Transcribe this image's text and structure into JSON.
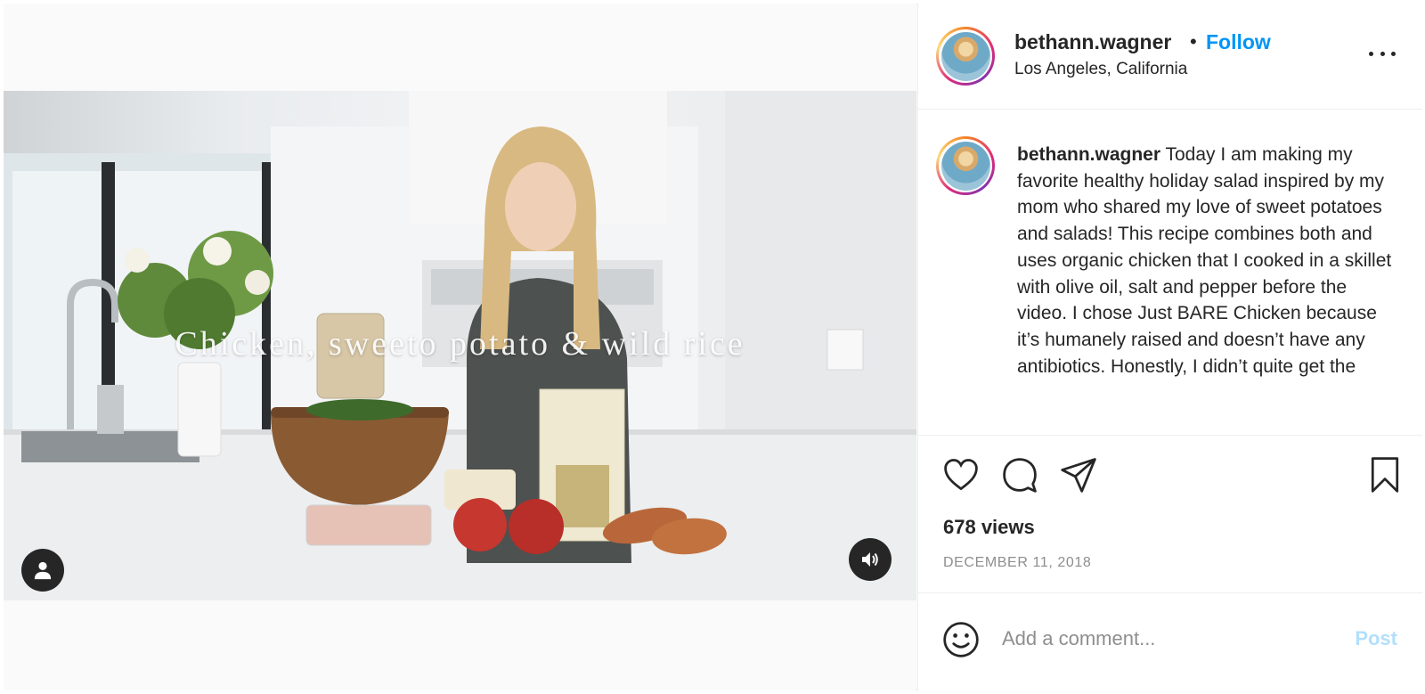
{
  "post": {
    "overlay_text": "Chicken, sweeto potato & wild rice",
    "media_icons": {
      "user_tag": "person-icon",
      "sound": "speaker-icon"
    }
  },
  "header": {
    "username": "bethann.wagner",
    "separator": "•",
    "follow_label": "Follow",
    "location": "Los Angeles, California"
  },
  "caption": {
    "username": "bethann.wagner",
    "text": "Today I am making my favorite healthy holiday salad inspired by my mom who shared my love of sweet potatoes and salads! This recipe combines both and uses organic chicken that I cooked in a skillet with olive oil, salt and pepper before the video. I chose Just BARE Chicken because it’s humanely raised and doesn’t have any antibiotics. Honestly, I didn’t quite get the"
  },
  "actions": {
    "icons": [
      "heart-icon",
      "comment-icon",
      "share-icon",
      "bookmark-icon"
    ],
    "views": "678 views",
    "date": "DECEMBER 11, 2018"
  },
  "comment": {
    "placeholder": "Add a comment...",
    "post_label": "Post"
  },
  "colors": {
    "accent": "#0095f6",
    "post_disabled": "#b2dffc",
    "muted": "#8e8e8e",
    "text": "#262626"
  }
}
